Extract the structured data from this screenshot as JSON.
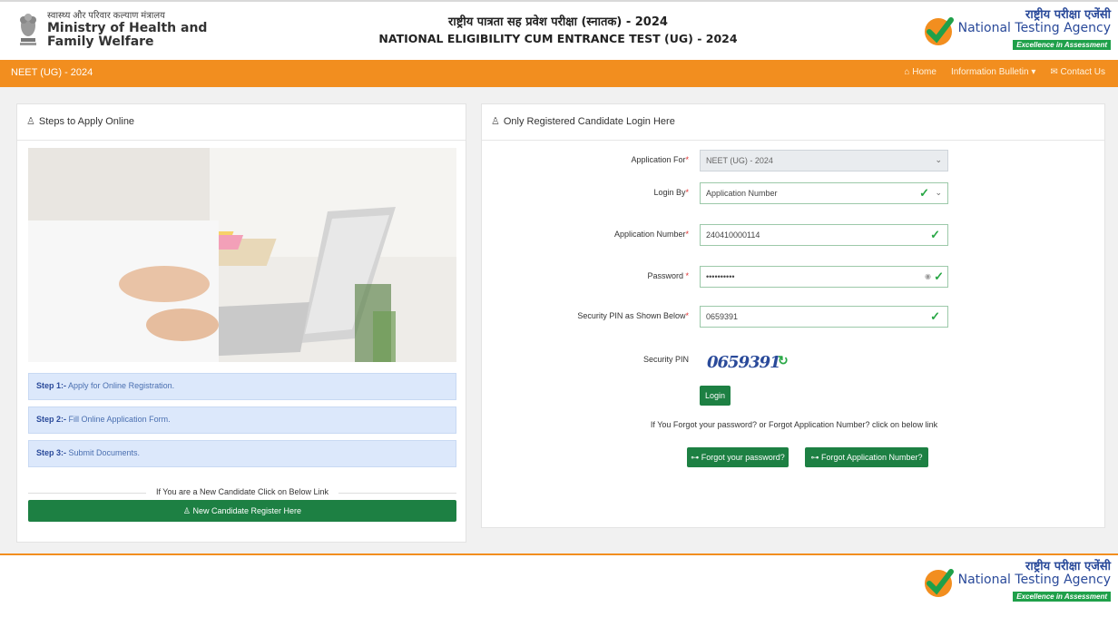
{
  "header": {
    "ministry_hindi": "स्वास्थ्य और परिवार कल्याण मंत्रालय",
    "ministry_line1": "Ministry of Health and",
    "ministry_line2": "Family Welfare",
    "title_hindi": "राष्ट्रीय पात्रता सह प्रवेश परीक्षा (स्नातक) - 2024",
    "title_english": "NATIONAL ELIGIBILITY CUM ENTRANCE TEST (UG) - 2024",
    "nta_hindi": "राष्ट्रीय परीक्षा एजेंसी",
    "nta_english": "National Testing Agency",
    "nta_tagline": "Excellence in Assessment"
  },
  "navbar": {
    "brand": "NEET (UG) - 2024",
    "home": "Home",
    "bulletin": "Information Bulletin",
    "contact": "Contact Us"
  },
  "steps_card": {
    "title": "Steps to Apply Online",
    "steps": [
      {
        "label": "Step 1:-",
        "text": "Apply for Online Registration."
      },
      {
        "label": "Step 2:-",
        "text": "Fill Online Application Form."
      },
      {
        "label": "Step 3:-",
        "text": "Submit Documents."
      }
    ],
    "new_candidate_text": "If You are a New Candidate Click on Below Link",
    "register_button": "New Candidate Register Here"
  },
  "login_card": {
    "title": "Only Registered Candidate Login Here",
    "application_for_label": "Application For",
    "application_for_value": "NEET (UG) - 2024",
    "login_by_label": "Login By",
    "login_by_value": "Application Number",
    "application_number_label": "Application Number",
    "application_number_value": "240410000114",
    "password_label": "Password",
    "password_value": "••••••••••",
    "security_pin_input_label": "Security PIN as Shown Below",
    "security_pin_input_value": "0659391",
    "security_pin_label": "Security PIN",
    "captcha_text": "0659391",
    "login_button": "Login",
    "forgot_text": "If You Forgot your password? or Forgot Application Number? click on below link",
    "forgot_password_button": "Forgot your password?",
    "forgot_app_number_button": "Forgot Application Number?"
  },
  "footer": {
    "nta_hindi": "राष्ट्रीय परीक्षा एजेंसी",
    "nta_english": "National Testing Agency",
    "nta_tagline": "Excellence in Assessment"
  },
  "colors": {
    "orange": "#f28e1f",
    "green": "#1d8043",
    "step_bg": "#dce8fb",
    "nta_blue": "#2a4a9a"
  }
}
